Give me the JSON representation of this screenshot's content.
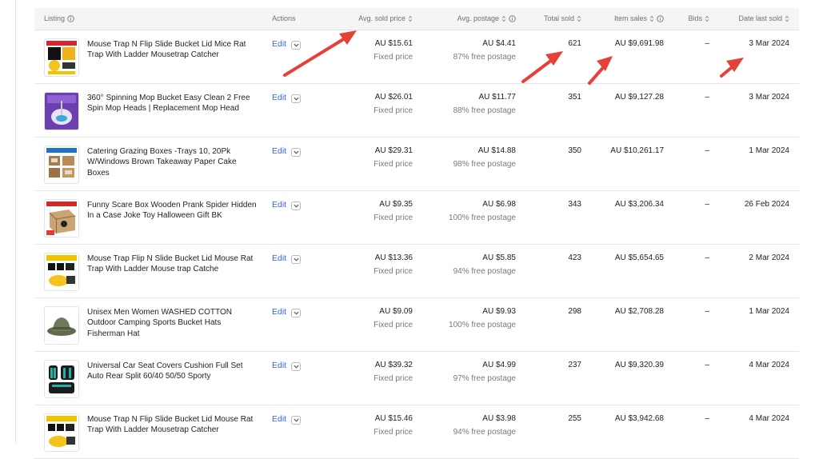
{
  "columns": {
    "listing": "Listing",
    "actions": "Actions",
    "avg_sold_price": "Avg. sold price",
    "avg_postage": "Avg. postage",
    "total_sold": "Total sold",
    "item_sales": "Item sales",
    "bids": "Bids",
    "date_last_sold": "Date last sold"
  },
  "edit_label": "Edit",
  "rows": [
    {
      "title": "Mouse Trap N Flip Slide Bucket Lid Mice Rat Trap With Ladder Mousetrap Catcher",
      "price": "AU $15.61",
      "price_type": "Fixed price",
      "postage": "AU $4.41",
      "free_postage": "87% free postage",
      "total_sold": "621",
      "item_sales": "AU $9,691.98",
      "bids": "–",
      "date": "3 Mar 2024"
    },
    {
      "title": "360° Spinning Mop Bucket Easy Clean 2 Free Spin Mop Heads | Replacement Mop Head",
      "price": "AU $26.01",
      "price_type": "Fixed price",
      "postage": "AU $11.77",
      "free_postage": "88% free postage",
      "total_sold": "351",
      "item_sales": "AU $9,127.28",
      "bids": "–",
      "date": "3 Mar 2024"
    },
    {
      "title": "Catering Grazing Boxes -Trays 10, 20Pk W/Windows Brown Takeaway Paper Cake Boxes",
      "price": "AU $29.31",
      "price_type": "Fixed price",
      "postage": "AU $14.88",
      "free_postage": "98% free postage",
      "total_sold": "350",
      "item_sales": "AU $10,261.17",
      "bids": "–",
      "date": "1 Mar 2024"
    },
    {
      "title": "Funny Scare Box Wooden Prank Spider Hidden In a Case Joke Toy Halloween Gift BK",
      "price": "AU $9.35",
      "price_type": "Fixed price",
      "postage": "AU $6.98",
      "free_postage": "100% free postage",
      "total_sold": "343",
      "item_sales": "AU $3,206.34",
      "bids": "–",
      "date": "26 Feb 2024"
    },
    {
      "title": "Mouse Trap Flip N Slide Bucket Lid Mouse Rat Trap With Ladder Mouse trap Catche",
      "price": "AU $13.36",
      "price_type": "Fixed price",
      "postage": "AU $5.85",
      "free_postage": "94% free postage",
      "total_sold": "423",
      "item_sales": "AU $5,654.65",
      "bids": "–",
      "date": "2 Mar 2024"
    },
    {
      "title": "Unisex Men Women WASHED COTTON Outdoor Camping Sports Bucket Hats Fisherman Hat",
      "price": "AU $9.09",
      "price_type": "Fixed price",
      "postage": "AU $9.93",
      "free_postage": "100% free postage",
      "total_sold": "298",
      "item_sales": "AU $2,708.28",
      "bids": "–",
      "date": "1 Mar 2024"
    },
    {
      "title": "Universal Car Seat Covers Cushion Full Set Auto Rear Split 60/40 50/50 Sporty",
      "price": "AU $39.32",
      "price_type": "Fixed price",
      "postage": "AU $4.99",
      "free_postage": "97% free postage",
      "total_sold": "237",
      "item_sales": "AU $9,320.39",
      "bids": "–",
      "date": "4 Mar 2024"
    },
    {
      "title": "Mouse Trap N Flip Slide Bucket Lid Mouse Rat Trap With Ladder Mousetrap Catcher",
      "price": "AU $15.46",
      "price_type": "Fixed price",
      "postage": "AU $3.98",
      "free_postage": "94% free postage",
      "total_sold": "255",
      "item_sales": "AU $3,942.68",
      "bids": "–",
      "date": "4 Mar 2024"
    }
  ],
  "colors": {
    "link": "#3665f3",
    "annotation_arrow": "#e5403a",
    "header_bg": "#f5f5f5"
  }
}
